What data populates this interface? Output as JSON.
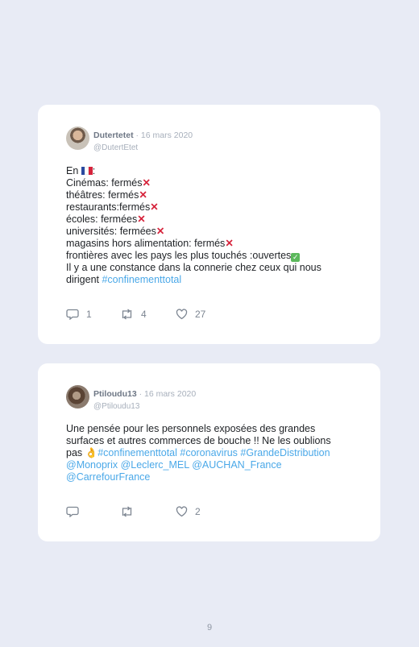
{
  "tweets": [
    {
      "display_name": "Dutertetet",
      "date": " · 16 mars 2020",
      "handle": "@DutertEtet",
      "lines": {
        "l1": "En ",
        "l1b": ":",
        "l2": "Cinémas: fermés",
        "l3": "théâtres: fermés",
        "l4": "restaurants:fermés",
        "l5": "écoles: fermées",
        "l6": "universités: fermées",
        "l7": "magasins hors alimentation: fermés",
        "l8": "frontières avec les pays les plus touchés :ouvertes",
        "l9": "Il y a une constance dans la connerie chez ceux qui nous",
        "l10": "dirigent ",
        "l10_link": "#confinementtotal"
      },
      "replies": "1",
      "retweets": "4",
      "likes": "27"
    },
    {
      "display_name": "Ptiloudu13",
      "date": " · 16 mars 2020",
      "handle": "@Ptiloudu13",
      "lines": {
        "l1": "Une pensée pour les personnels exposées des grandes",
        "l2": "surfaces et autres commerces de bouche !! Ne les oublions",
        "l3": "pas ",
        "l3_link": "#confinementtotal #coronavirus #GrandeDistribution",
        "l4_link": "@Monoprix @Leclerc_MEL @AUCHAN_France",
        "l5_link": "@CarrefourFrance"
      },
      "replies": "",
      "retweets": "",
      "likes": "2"
    }
  ],
  "emoji": {
    "cross": "✕",
    "check": "✓",
    "hand": "👌"
  },
  "page_number": "9",
  "colors": {
    "background": "#e8ebf5",
    "link": "#4aa8e8",
    "cross": "#d6243c",
    "check": "#5cb85c"
  }
}
